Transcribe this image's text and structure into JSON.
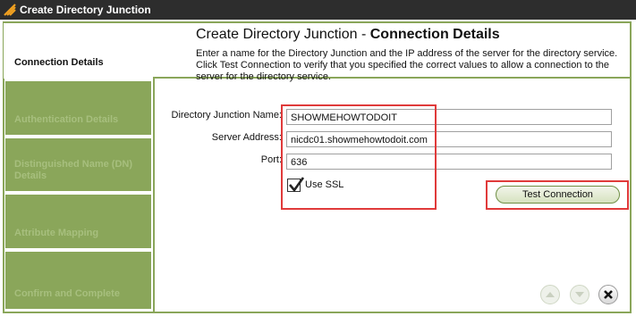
{
  "window": {
    "title": "Create Directory Junction"
  },
  "sidebar": {
    "items": [
      {
        "label": "Connection Details"
      },
      {
        "label": "Authentication Details"
      },
      {
        "label": "Distinguished Name (DN) Details"
      },
      {
        "label": "Attribute Mapping"
      },
      {
        "label": "Confirm and Complete"
      }
    ]
  },
  "main": {
    "heading_prefix": "Create Directory Junction",
    "heading_separator": " - ",
    "heading_bold": "Connection Details",
    "description": "Enter a name for the Directory Junction and the IP address of the server for the directory service. Click Test Connection to verify that you specified the correct values to allow a connection to the server for the directory service."
  },
  "form": {
    "name_label": "Directory Junction Name:",
    "name_value": "SHOWMEHOWTODOIT",
    "address_label": "Server Address:",
    "address_value": "nicdc01.showmehowtodoit.com",
    "port_label": "Port:",
    "port_value": "636",
    "ssl_label": "Use SSL",
    "ssl_checked": true,
    "test_button": "Test Connection"
  },
  "footer": {
    "icons": [
      "up-arrow-icon",
      "down-arrow-icon",
      "close-icon"
    ]
  },
  "colors": {
    "nav_green": "#8aa65a",
    "highlight_red": "#e03a3a",
    "titlebar": "#2d2d2d"
  }
}
